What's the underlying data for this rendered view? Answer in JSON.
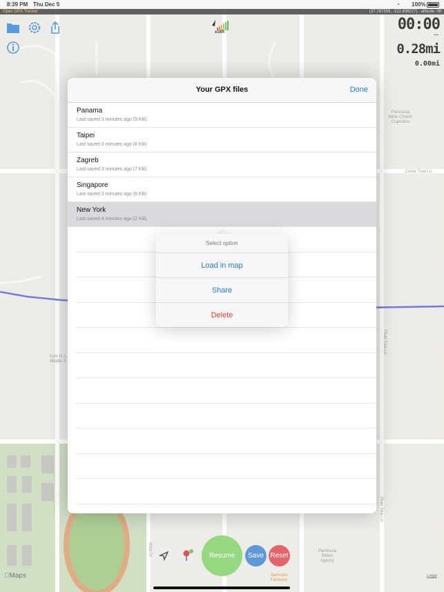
{
  "status_bar": {
    "time": "8:39 PM",
    "date": "Thu Dec 5",
    "battery": "100%"
  },
  "app_bar": {
    "app_name": "Open GPX Tracker",
    "coordinates": "(37.787359, -122.408227) · altitude: 0ft"
  },
  "gps": {
    "accuracy": "±16ft"
  },
  "tracking": {
    "elapsed": "00:00",
    "dots": "...",
    "total_distance": "0.28mi",
    "segment_distance": "0.00mi"
  },
  "map_labels": {
    "church": "Peninsula\nBible Church\nCupertino",
    "street_cedar": "Cedar Tree Ln",
    "school": "Sam H. L\nMiddle S",
    "plum1": "Plum Tree Ln",
    "plum2": "Plum Tree Ln",
    "vista": "Vista Dr",
    "sitters": "Peninsula\nSitters\nAgency",
    "samudra": "Samudra\nFashions",
    "maps_brand": "Maps",
    "legal": "Legal"
  },
  "modal": {
    "title": "Your GPX files",
    "done_label": "Done",
    "files": [
      {
        "name": "Panama",
        "meta": "Last saved 3 minutes ago (9 KB)"
      },
      {
        "name": "Taipei",
        "meta": "Last saved 3 minutes ago (8 KB)"
      },
      {
        "name": "Zagreb",
        "meta": "Last saved 3 minutes ago (7 KB)"
      },
      {
        "name": "Singapore",
        "meta": "Last saved 3 minutes ago (6 KB)"
      },
      {
        "name": "New York",
        "meta": "Last saved 4 minutes ago (2 KB)"
      }
    ],
    "selected_index": 4
  },
  "popover": {
    "title": "Select option",
    "options": [
      {
        "label": "Load in map",
        "color": "#1f7ad6"
      },
      {
        "label": "Share",
        "color": "#1f7ad6"
      },
      {
        "label": "Delete",
        "color": "#e0413a"
      }
    ]
  },
  "bottom_controls": {
    "resume_label": "Resume",
    "save_label": "Save",
    "reset_label": "Reset"
  },
  "colors": {
    "accent": "#1f7ad6",
    "resume": "#7ed063",
    "save": "#3b82d0",
    "reset": "#e0414a",
    "track": "#5a5ad8"
  }
}
